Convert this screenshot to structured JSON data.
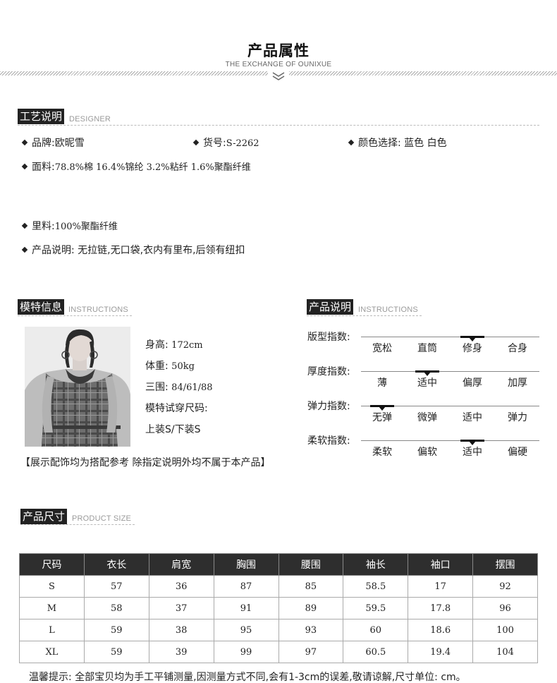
{
  "header": {
    "title": "产品属性",
    "subtitle": "THE EXCHANGE OF OUNIXUE"
  },
  "craft": {
    "tag": "工艺说明",
    "tag_en": "DESIGNER",
    "brand": "品牌:欧昵雪",
    "item_no_label": "货号:",
    "item_no": "S-2262",
    "colors": "颜色选择: 蓝色 白色",
    "fabric_label": "面料:",
    "fabric": "78.8%棉 16.4%锦纶 3.2%粘纤 1.6%聚酯纤维",
    "lining_label": "里料:",
    "lining": "100%聚酯纤维",
    "description": "产品说明: 无拉链,无口袋,衣内有里布,后领有纽扣"
  },
  "model": {
    "tag": "模特信息",
    "tag_en": "INSTRUCTIONS",
    "height_label": "身高:",
    "height": "172cm",
    "weight_label": "体重:",
    "weight": "50kg",
    "measurements_label": "三围:",
    "measurements": "84/61/88",
    "tried_size_label": "模特试穿尺码:",
    "tried_size": "上装S/下装S",
    "notice": "【展示配饰均为搭配参考 除指定说明外均不属于本产品】"
  },
  "product_desc": {
    "tag": "产品说明",
    "tag_en": "INSTRUCTIONS",
    "indices": [
      {
        "label": "版型指数:",
        "options": [
          "宽松",
          "直筒",
          "修身",
          "合身"
        ],
        "selected": 2
      },
      {
        "label": "厚度指数:",
        "options": [
          "薄",
          "适中",
          "偏厚",
          "加厚"
        ],
        "selected": 1
      },
      {
        "label": "弹力指数:",
        "options": [
          "无弹",
          "微弹",
          "适中",
          "弹力"
        ],
        "selected": 0
      },
      {
        "label": "柔软指数:",
        "options": [
          "柔软",
          "偏软",
          "适中",
          "偏硬"
        ],
        "selected": 2
      }
    ]
  },
  "size_section": {
    "tag": "产品尺寸",
    "tag_en": "PRODUCT SIZE",
    "columns": [
      "尺码",
      "衣长",
      "肩宽",
      "胸围",
      "腰围",
      "袖长",
      "袖口",
      "摆围"
    ],
    "rows": [
      [
        "S",
        "57",
        "36",
        "87",
        "85",
        "58.5",
        "17",
        "92"
      ],
      [
        "M",
        "58",
        "37",
        "91",
        "89",
        "59.5",
        "17.8",
        "96"
      ],
      [
        "L",
        "59",
        "38",
        "95",
        "93",
        "60",
        "18.6",
        "100"
      ],
      [
        "XL",
        "59",
        "39",
        "99",
        "97",
        "60.5",
        "19.4",
        "104"
      ]
    ],
    "tip": "温馨提示: 全部宝贝均为手工平铺测量,因测量方式不同,会有1-3cm的误差,敬请谅解,尺寸单位: cm。"
  }
}
